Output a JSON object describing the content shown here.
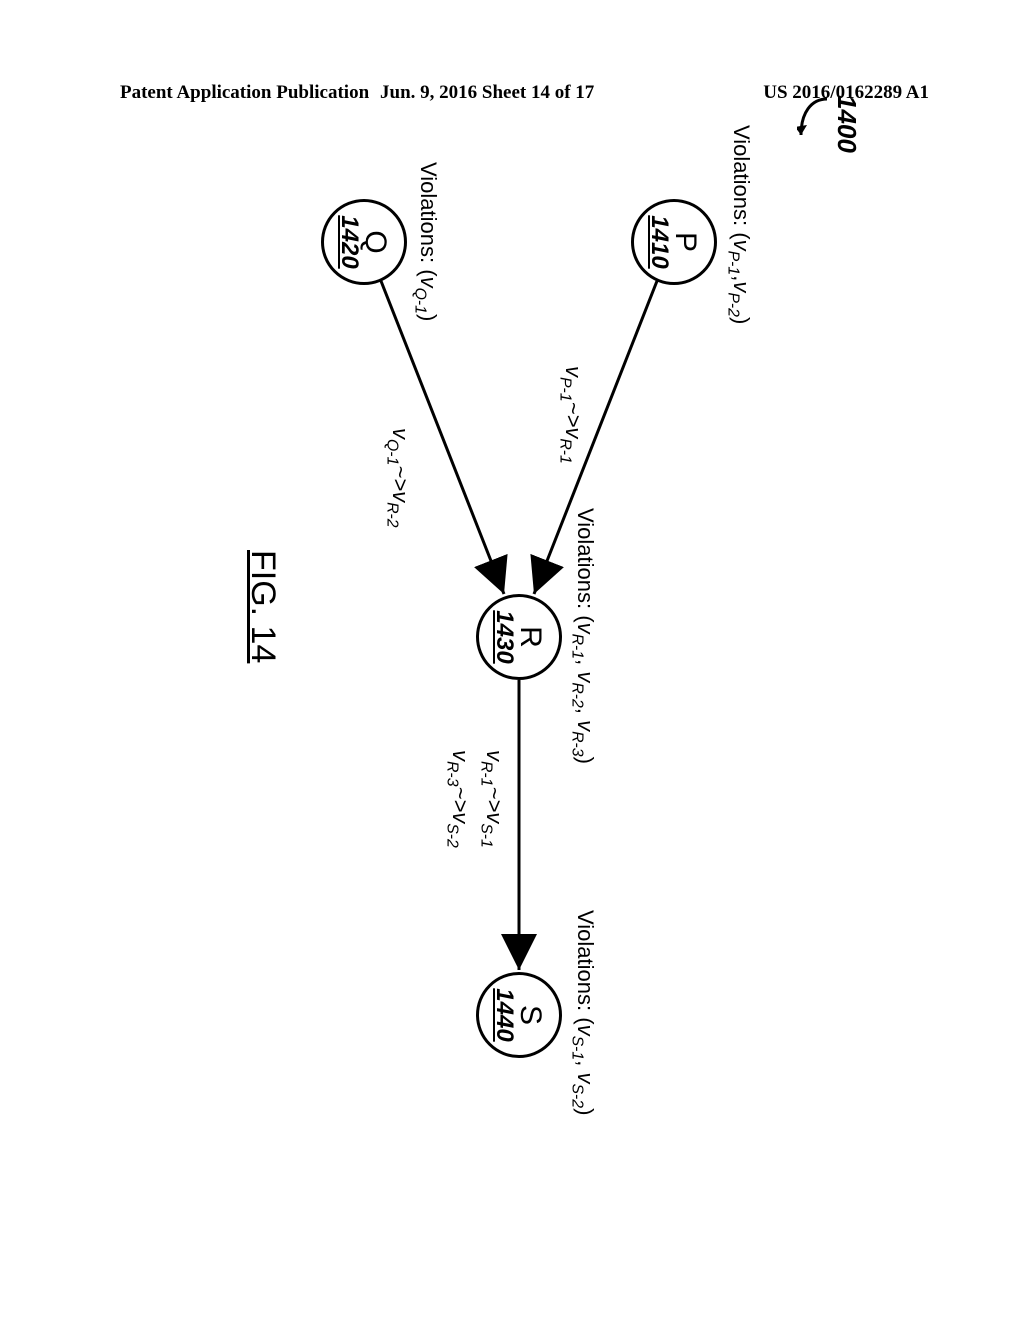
{
  "header": {
    "left": "Patent Application Publication",
    "mid": "Jun. 9, 2016  Sheet 14 of 17",
    "right": "US 2016/0162289 A1"
  },
  "figure": {
    "ref_number": "1400",
    "caption": "FIG. 14",
    "nodes": {
      "P": {
        "letter": "P",
        "num": "1410",
        "violations_label": "Violations:",
        "violations_html": "(<span class='vi'>v<sub>P-1</sub></span>,<span class='vi'>v<sub>P-2</sub></span>)"
      },
      "Q": {
        "letter": "Q",
        "num": "1420",
        "violations_label": "Violations:",
        "violations_html": "(<span class='vi'>v<sub>Q-1</sub></span>)"
      },
      "R": {
        "letter": "R",
        "num": "1430",
        "violations_label": "Violations:",
        "violations_html": "(<span class='vi'>v<sub>R-1</sub></span>, <span class='vi'>v<sub>R-2</sub></span>, <span class='vi'>v<sub>R-3</sub></span>)"
      },
      "S": {
        "letter": "S",
        "num": "1440",
        "violations_label": "Violations:",
        "violations_html": "(<span class='vi'>v<sub>S-1</sub></span>, <span class='vi'>v<sub>S-2</sub></span>)"
      }
    },
    "edges": {
      "PR": {
        "html": "<span class='vi'>v<sub>P-1</sub></span>~&gt;<span class='vi'>v<sub>R-1</sub></span>"
      },
      "QR": {
        "html": "<span class='vi'>v<sub>Q-1</sub></span>~&gt;<span class='vi'>v<sub>R-2</sub></span>"
      },
      "RS": {
        "html": "<span class='vi'>v<sub>R-1</sub></span>~&gt;<span class='vi'>v<sub>S-1</sub></span><br><span class='vi'>v<sub>R-3</sub></span>~&gt;<span class='vi'>v<sub>S-2</sub></span>"
      }
    }
  },
  "chart_data": {
    "type": "diagram",
    "title": "FIG. 14",
    "reference_number": "1400",
    "nodes": [
      {
        "id": "P",
        "ref": "1410",
        "violations": [
          "v_{P-1}",
          "v_{P-2}"
        ]
      },
      {
        "id": "Q",
        "ref": "1420",
        "violations": [
          "v_{Q-1}"
        ]
      },
      {
        "id": "R",
        "ref": "1430",
        "violations": [
          "v_{R-1}",
          "v_{R-2}",
          "v_{R-3}"
        ]
      },
      {
        "id": "S",
        "ref": "1440",
        "violations": [
          "v_{S-1}",
          "v_{S-2}"
        ]
      }
    ],
    "edges": [
      {
        "from": "P",
        "to": "R",
        "mappings": [
          [
            "v_{P-1}",
            "v_{R-1}"
          ]
        ]
      },
      {
        "from": "Q",
        "to": "R",
        "mappings": [
          [
            "v_{Q-1}",
            "v_{R-2}"
          ]
        ]
      },
      {
        "from": "R",
        "to": "S",
        "mappings": [
          [
            "v_{R-1}",
            "v_{S-1}"
          ],
          [
            "v_{R-3}",
            "v_{S-2}"
          ]
        ]
      }
    ]
  }
}
